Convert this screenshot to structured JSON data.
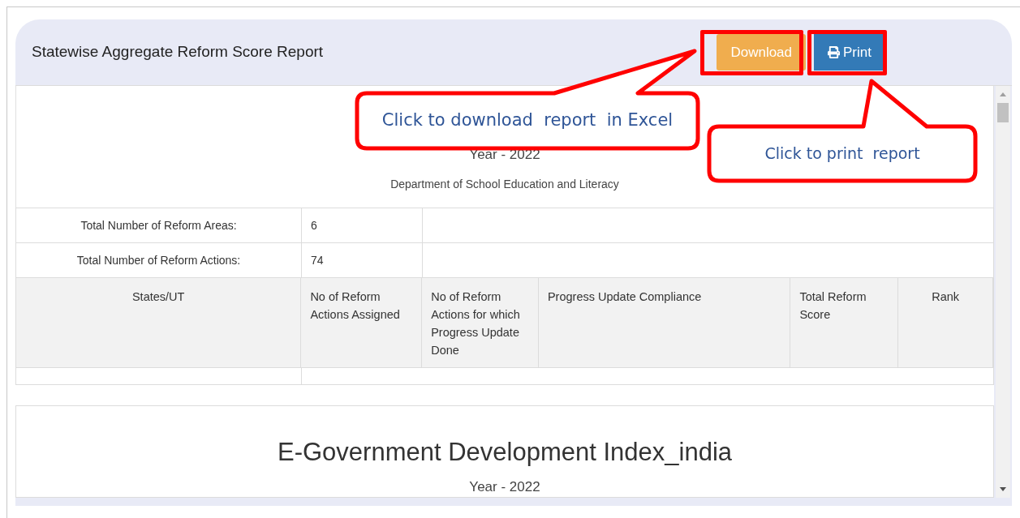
{
  "header": {
    "title": "Statewise Aggregate Reform Score Report"
  },
  "buttons": [
    {
      "label": "Download",
      "kind": "download"
    },
    {
      "label": "Print",
      "kind": "print"
    }
  ],
  "report": {
    "year": "Year - 2022",
    "department": "Department of School Education and Literacy",
    "summary": [
      {
        "label": "Total Number of Reform Areas:",
        "value": "6"
      },
      {
        "label": "Total Number of Reform Actions:",
        "value": "74"
      }
    ],
    "columns": [
      "States/UT",
      "No of Reform Actions Assigned",
      "No of Reform Actions for which Progress Update Done",
      "Progress Update Compliance",
      "Total Reform Score",
      "Rank"
    ]
  },
  "next_report": {
    "title": "E-Government Development Index_india",
    "year": "Year - 2022"
  },
  "callouts": [
    {
      "text": "Click to download  report  in Excel"
    },
    {
      "text": "Click to print  report"
    }
  ]
}
